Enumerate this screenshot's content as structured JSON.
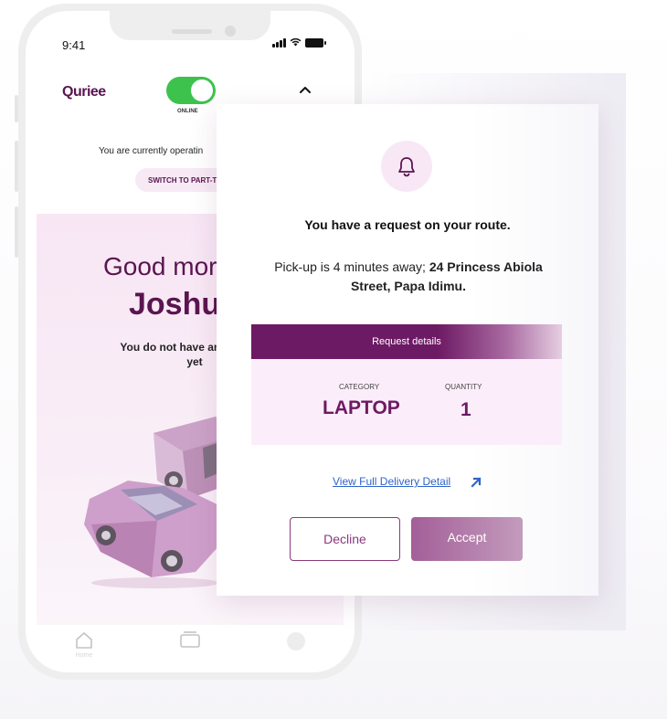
{
  "status_bar": {
    "time": "9:41"
  },
  "app": {
    "logo": "Quriee",
    "toggle_label": "ONLINE"
  },
  "header": {
    "operating_text": "You are currently operatin",
    "switch_button": "SWITCH TO PART-T"
  },
  "home": {
    "greeting": "Good mor",
    "name": "Joshu",
    "no_request_text": "You do not have any request yet"
  },
  "tabs": [
    {
      "icon": "home-icon",
      "label": "Home"
    },
    {
      "icon": "cards-icon",
      "label": ""
    },
    {
      "icon": "profile-icon",
      "label": ""
    }
  ],
  "modal": {
    "title": "You have a request on your route.",
    "pickup_prefix": "Pick-up is 4 minutes away; ",
    "pickup_address": "24 Princess Abiola Street, Papa Idimu.",
    "details_header": "Request details",
    "category_label": "CATEGORY",
    "category_value": "LAPTOP",
    "quantity_label": "QUANTITY",
    "quantity_value": "1",
    "view_link": "View Full Delivery Detail",
    "decline_label": "Decline",
    "accept_label": "Accept"
  },
  "colors": {
    "brand": "#5a1550",
    "accent": "#6d1a64",
    "online_green": "#3ec24e",
    "link_blue": "#2f64c8"
  }
}
